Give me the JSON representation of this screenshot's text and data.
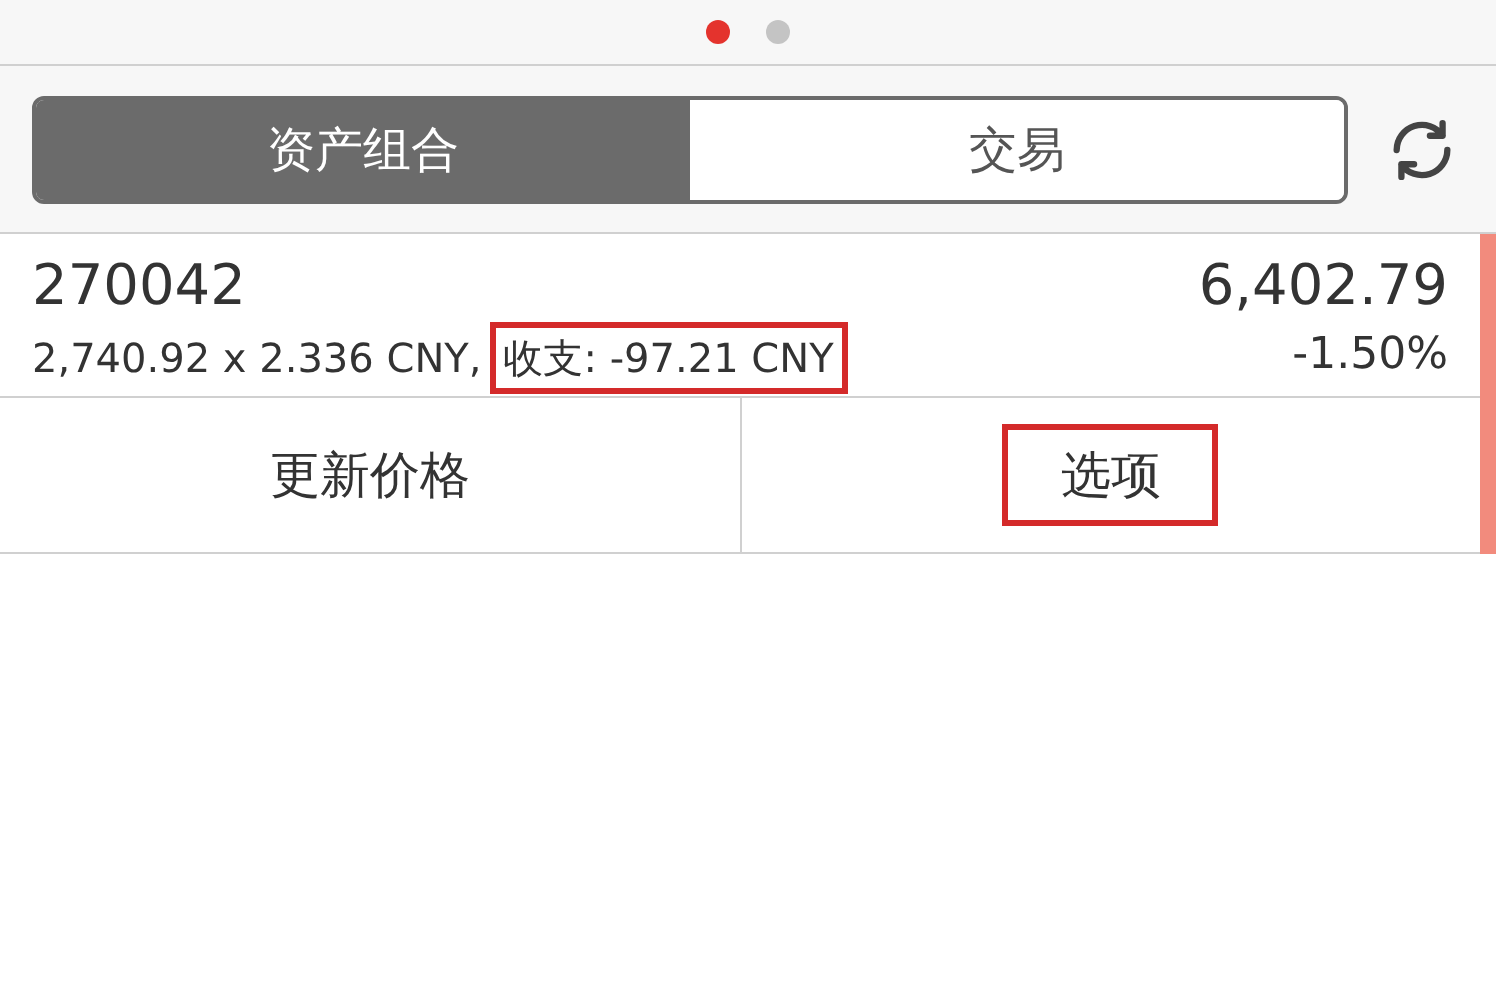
{
  "page_dots": [
    {
      "selected": true
    },
    {
      "selected": false
    }
  ],
  "segments": [
    {
      "label": "资产组合",
      "selected": true
    },
    {
      "label": "交易",
      "selected": false
    }
  ],
  "holding": {
    "code": "270042",
    "detail": "2,740.92 x 2.336 CNY,",
    "pnl": {
      "text": "收支: -97.21 CNY",
      "highlighted": true
    },
    "value": "6,402.79",
    "change": "-1.50%",
    "color": "#f28b7d"
  },
  "actions": [
    {
      "label": "更新价格",
      "highlighted": false
    },
    {
      "label": "选项",
      "highlighted": true
    }
  ]
}
